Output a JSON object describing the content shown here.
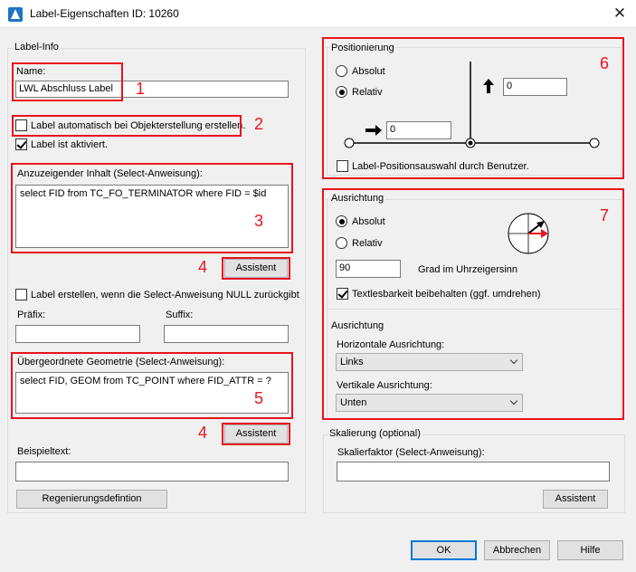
{
  "window": {
    "title": "Label-Eigenschaften ID: 10260",
    "close_glyph": "✕"
  },
  "label_info": {
    "group_label": "Label-Info",
    "name_label": "Name:",
    "name_value": "LWL Abschluss Label",
    "auto_create_label": "Label automatisch bei Objekterstellung erstellen.",
    "auto_create_checked": false,
    "activated_label": "Label ist aktiviert.",
    "activated_checked": true,
    "content_label": "Anzuzeigender Inhalt (Select-Anweisung):",
    "content_value": "select FID from TC_FO_TERMINATOR where FID = $id",
    "assistant_label": "Assistent",
    "null_label": "Label erstellen, wenn die Select-Anweisung NULL zurückgibt",
    "null_checked": false,
    "prefix_label": "Präfix:",
    "prefix_value": "",
    "suffix_label": "Suffix:",
    "suffix_value": "",
    "parent_geom_label": "Übergeordnete Geometrie (Select-Anweisung):",
    "parent_geom_value": "select FID, GEOM from TC_POINT where FID_ATTR = ?",
    "example_label": "Beispieltext:",
    "example_value": "",
    "regen_button": "Regenierungsdefintion"
  },
  "positioning": {
    "group_label": "Positionierung",
    "absolute_label": "Absolut",
    "relative_label": "Relativ",
    "selected": "Relativ",
    "y_value": "0",
    "x_value": "0",
    "user_select_label": "Label-Positionsauswahl durch Benutzer.",
    "user_select_checked": false
  },
  "orientation": {
    "group_label": "Ausrichtung",
    "absolute_label": "Absolut",
    "relative_label": "Relativ",
    "selected": "Absolut",
    "degrees_value": "90",
    "degrees_label": "Grad im Uhrzeigersinn",
    "keep_readable_label": "Textlesbarkeit beibehalten (ggf. umdrehen)",
    "keep_readable_checked": true,
    "align_group_label": "Ausrichtung",
    "horizontal_label": "Horizontale Ausrichtung:",
    "horizontal_value": "Links",
    "vertical_label": "Vertikale Ausrichtung:",
    "vertical_value": "Unten"
  },
  "scaling": {
    "group_label": "Skalierung (optional)",
    "factor_label": "Skalierfaktor (Select-Anweisung):",
    "factor_value": "",
    "assistant_label": "Assistent"
  },
  "footer": {
    "ok": "OK",
    "cancel": "Abbrechen",
    "help": "Hilfe"
  },
  "annotations": [
    "1",
    "2",
    "3",
    "4",
    "4",
    "5",
    "6",
    "7"
  ],
  "colors": {
    "annotation_red": "#e8141d",
    "compass_arrow_red": "#e8141d",
    "primary_blue": "#0078d7"
  }
}
